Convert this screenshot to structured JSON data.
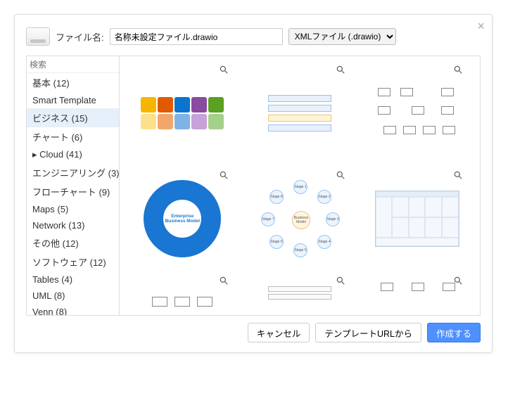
{
  "header": {
    "filename_label": "ファイル名:",
    "filename_value": "名称未設定ファイル.drawio",
    "filetype_selected": "XMLファイル (.drawio)"
  },
  "sidebar": {
    "search_placeholder": "検索",
    "categories": [
      {
        "label": "基本 (12)"
      },
      {
        "label": "Smart Template"
      },
      {
        "label": "ビジネス (15)",
        "selected": true
      },
      {
        "label": "チャート (6)"
      },
      {
        "label": "▸ Cloud (41)"
      },
      {
        "label": "エンジニアリング (3)"
      },
      {
        "label": "フローチャート (9)"
      },
      {
        "label": "Maps (5)"
      },
      {
        "label": "Network (13)"
      },
      {
        "label": "その他 (12)"
      },
      {
        "label": "ソフトウェア (12)"
      },
      {
        "label": "Tables (4)"
      },
      {
        "label": "UML (8)"
      },
      {
        "label": "Venn (8)"
      }
    ]
  },
  "templates": {
    "circle_center_text": "Enterprise Business Model",
    "stage_center": "Business Model",
    "stage_labels": [
      "Stage 1",
      "Stage 2",
      "Stage 3",
      "Stage 4",
      "Stage 5",
      "Stage 6",
      "Stage 7",
      "Stage 8"
    ]
  },
  "footer": {
    "cancel": "キャンセル",
    "from_url": "テンプレートURLから",
    "create": "作成する"
  }
}
